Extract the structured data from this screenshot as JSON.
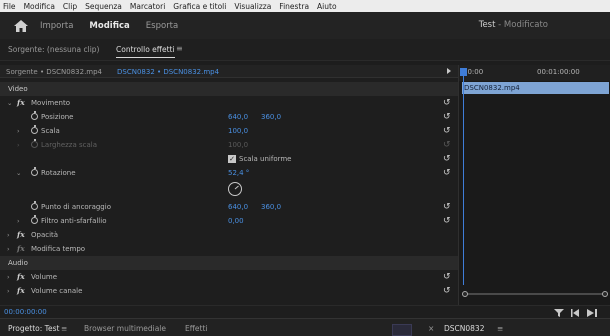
{
  "menu": [
    "File",
    "Modifica",
    "Clip",
    "Sequenza",
    "Marcatori",
    "Grafica e titoli",
    "Visualizza",
    "Finestra",
    "Aiuto"
  ],
  "header": {
    "tabs": [
      "Importa",
      "Modifica",
      "Esporta"
    ],
    "active": "Modifica",
    "title": "Test",
    "title_suffix": " - Modificato"
  },
  "panels": {
    "source": "Sorgente: (nessuna clip)",
    "effect_controls": "Controllo effetti"
  },
  "ec": {
    "source_clip": "Sorgente • DSCN0832.mp4",
    "seq_clip": "DSCN0832 • DSCN0832.mp4",
    "video_header": "Video",
    "audio_header": "Audio",
    "effects": {
      "movimento": "Movimento",
      "posizione": {
        "label": "Posizione",
        "x": "640,0",
        "y": "360,0"
      },
      "scala": {
        "label": "Scala",
        "value": "100,0"
      },
      "larghezza": {
        "label": "Larghezza scala",
        "value": "100,0"
      },
      "uniform": "Scala uniforme",
      "rotazione": {
        "label": "Rotazione",
        "value": "52,4 °"
      },
      "ancoraggio": {
        "label": "Punto di ancoraggio",
        "x": "640,0",
        "y": "360,0"
      },
      "sfarfallio": {
        "label": "Filtro anti-sfarfallio",
        "value": "0,00"
      },
      "opacita": "Opacità",
      "tempo": "Modifica tempo",
      "volume": "Volume",
      "volume_canale": "Volume canale"
    }
  },
  "timeline": {
    "t0": "00:00",
    "t1": "00:01:00:00",
    "clip": "DSCN0832.mp4"
  },
  "status": {
    "timecode": "00:00:00:00"
  },
  "bottom": {
    "project": "Progetto: Test",
    "browser": "Browser multimediale",
    "effetti": "Effetti",
    "program": "DSCN0832"
  }
}
